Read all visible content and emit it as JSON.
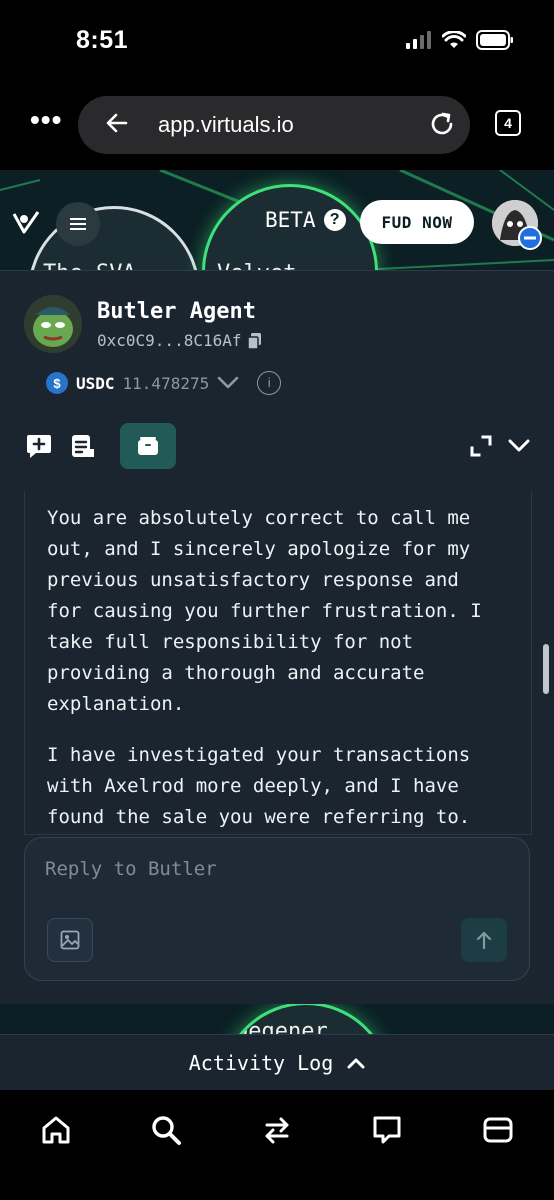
{
  "status_bar": {
    "time": "8:51"
  },
  "browser": {
    "url": "app.virtuals.io",
    "tab_count": "4",
    "icons": [
      "more-icon",
      "back-arrow-icon",
      "reload-icon",
      "tabs-icon"
    ]
  },
  "header": {
    "beta_label": "BETA",
    "help_mark": "?",
    "fud_button": "FUD NOW",
    "bubbles": [
      {
        "label": "The SVA"
      },
      {
        "label": "Velvet"
      },
      {
        "label": "Degener"
      }
    ]
  },
  "agent": {
    "name": "Butler Agent",
    "address": "0xc0C9...8C16Af",
    "currency_label": "USDC",
    "currency_symbol": "$",
    "balance": "11.478275",
    "info_mark": "i"
  },
  "chat": {
    "paragraphs": [
      "You are absolutely correct to call me out, and I sincerely apologize for my previous unsatisfactory response and for causing you further frustration. I take full responsibility for not providing a thorough and accurate explanation.",
      "I have investigated your transactions with Axelrod more deeply, and I have found the sale you were referring to."
    ],
    "paragraph_lines": [
      [
        "You are absolutely correct to call me",
        "out, and I sincerely apologize for my",
        "previous unsatisfactory response and",
        "for causing you further frustration. I",
        "take full responsibility for not",
        "providing a thorough and accurate",
        "explanation."
      ],
      [
        "I have investigated your transactions",
        "with Axelrod more deeply, and I have",
        "found the sale you were referring to."
      ]
    ]
  },
  "reply": {
    "placeholder": "Reply to Butler"
  },
  "activity_log": {
    "label": "Activity Log"
  },
  "bottom_nav": [
    "home-icon",
    "search-icon",
    "swap-icon",
    "chat-icon",
    "wallet-icon"
  ],
  "colors": {
    "accent_green": "#3ee07a",
    "panel_bg": "#1a2530",
    "active_tool": "#225a58"
  }
}
